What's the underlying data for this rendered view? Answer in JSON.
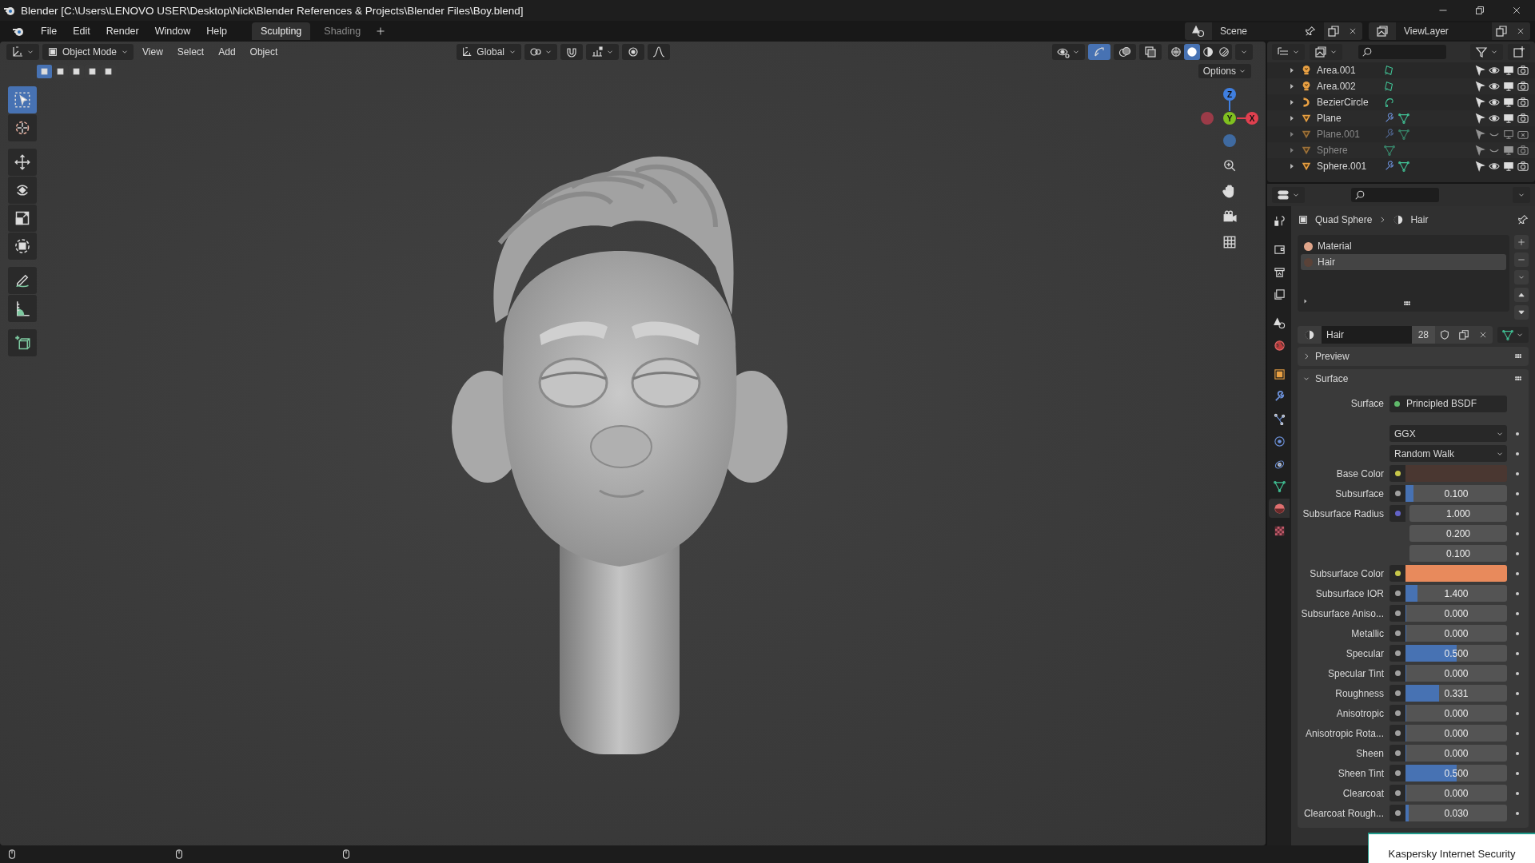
{
  "window": {
    "title": "Blender [C:\\Users\\LENOVO USER\\Desktop\\Nick\\Blender References & Projects\\Blender Files\\Boy.blend]"
  },
  "menu": [
    "File",
    "Edit",
    "Render",
    "Window",
    "Help"
  ],
  "workspaces": [
    {
      "label": "Sculpting",
      "selected": true
    },
    {
      "label": "Shading",
      "selected": false
    }
  ],
  "scene": "Scene",
  "view_layer": "ViewLayer",
  "viewport": {
    "mode": "Object Mode",
    "menus": [
      "View",
      "Select",
      "Add",
      "Object"
    ],
    "orientation": "Global",
    "options": "Options",
    "select_modes": [
      {
        "selected": true
      },
      {
        "selected": false
      },
      {
        "selected": false
      },
      {
        "selected": false
      },
      {
        "selected": false
      }
    ],
    "shading": [
      {
        "kind": "wireframe",
        "selected": false
      },
      {
        "kind": "solid",
        "selected": true
      },
      {
        "kind": "material",
        "selected": false
      },
      {
        "kind": "rendered",
        "selected": false
      }
    ],
    "tools": [
      {
        "kind": "select",
        "selected": true
      },
      {
        "kind": "cursor",
        "selected": false
      },
      {
        "kind": "move",
        "selected": false
      },
      {
        "kind": "rotate",
        "selected": false
      },
      {
        "kind": "scale",
        "selected": false
      },
      {
        "kind": "transform",
        "selected": false
      },
      {
        "kind": "annotate",
        "selected": false
      },
      {
        "kind": "measure",
        "selected": false
      },
      {
        "kind": "add_cube",
        "selected": false
      }
    ],
    "gizmo": {
      "x": "X",
      "y": "Y",
      "z": "Z"
    }
  },
  "outliner": {
    "items": [
      {
        "name": "Area.001",
        "kind": "light",
        "modifier": false,
        "visible": true,
        "render_enabled": true
      },
      {
        "name": "Area.002",
        "kind": "light",
        "modifier": false,
        "visible": true,
        "render_enabled": true
      },
      {
        "name": "BezierCircle",
        "kind": "curve",
        "modifier": false,
        "visible": true,
        "render_enabled": true
      },
      {
        "name": "Plane",
        "kind": "mesh",
        "modifier": true,
        "visible": true,
        "render_enabled": true
      },
      {
        "name": "Plane.001",
        "kind": "mesh",
        "modifier": true,
        "visible": false,
        "render_enabled": false
      },
      {
        "name": "Sphere",
        "kind": "mesh",
        "modifier": false,
        "visible": false,
        "render_enabled": true
      },
      {
        "name": "Sphere.001",
        "kind": "mesh",
        "modifier": true,
        "visible": true,
        "render_enabled": true
      }
    ]
  },
  "properties": {
    "tabs": [
      {
        "kind": "tool",
        "selected": false
      },
      {
        "kind": "render",
        "selected": false
      },
      {
        "kind": "output",
        "selected": false
      },
      {
        "kind": "view_layer",
        "selected": false
      },
      {
        "kind": "scene",
        "selected": false
      },
      {
        "kind": "world",
        "selected": false
      },
      {
        "kind": "object",
        "selected": false
      },
      {
        "kind": "modifiers",
        "selected": false
      },
      {
        "kind": "particles",
        "selected": false
      },
      {
        "kind": "physics",
        "selected": false
      },
      {
        "kind": "constraints",
        "selected": false
      },
      {
        "kind": "data",
        "selected": false
      },
      {
        "kind": "material",
        "selected": true
      },
      {
        "kind": "texture",
        "selected": false
      }
    ],
    "breadcrumb": [
      "Quad Sphere",
      "Hair"
    ],
    "slots": [
      {
        "name": "Material",
        "color": "#e0a58a",
        "selected": false
      },
      {
        "name": "Hair",
        "color": "#5a4238",
        "selected": true
      }
    ],
    "material": {
      "name": "Hair",
      "users": "28"
    },
    "panels": [
      {
        "title": "Preview",
        "expanded": false
      },
      {
        "title": "Surface",
        "expanded": true
      }
    ],
    "surface": {
      "label": "Surface",
      "shader": "Principled BSDF"
    },
    "dropdowns": [
      "GGX",
      "Random Walk"
    ],
    "params": [
      {
        "kind": "color",
        "label": "Base Color",
        "color": "#c7c74a",
        "swatch": {
          "color": "#4a3731"
        }
      },
      {
        "kind": "slider",
        "label": "Subsurface",
        "color": "#a1a1a1",
        "value": "0.100",
        "level": 0.08
      },
      {
        "kind": "vector",
        "label": "Subsurface Radius",
        "color": "#6363c7",
        "values": [
          "1.000",
          "0.200",
          "0.100"
        ]
      },
      {
        "kind": "color",
        "label": "Subsurface Color",
        "color": "#c7c74a",
        "swatch": {
          "color": "#e88a5c"
        }
      },
      {
        "kind": "slider",
        "label": "Subsurface IOR",
        "color": "#a1a1a1",
        "value": "1.400",
        "level": 0.12
      },
      {
        "kind": "slider",
        "label": "Subsurface Aniso...",
        "color": "#a1a1a1",
        "value": "0.000",
        "level": 0
      },
      {
        "kind": "slider",
        "label": "Metallic",
        "color": "#a1a1a1",
        "value": "0.000",
        "level": 0
      },
      {
        "kind": "slider",
        "label": "Specular",
        "color": "#a1a1a1",
        "value": "0.500",
        "level": 0.5
      },
      {
        "kind": "slider",
        "label": "Specular Tint",
        "color": "#a1a1a1",
        "value": "0.000",
        "level": 0
      },
      {
        "kind": "slider",
        "label": "Roughness",
        "color": "#a1a1a1",
        "value": "0.331",
        "level": 0.331
      },
      {
        "kind": "slider",
        "label": "Anisotropic",
        "color": "#a1a1a1",
        "value": "0.000",
        "level": 0
      },
      {
        "kind": "slider",
        "label": "Anisotropic Rota...",
        "color": "#a1a1a1",
        "value": "0.000",
        "level": 0
      },
      {
        "kind": "slider",
        "label": "Sheen",
        "color": "#a1a1a1",
        "value": "0.000",
        "level": 0
      },
      {
        "kind": "slider",
        "label": "Sheen Tint",
        "color": "#a1a1a1",
        "value": "0.500",
        "level": 0.5
      },
      {
        "kind": "slider",
        "label": "Clearcoat",
        "color": "#a1a1a1",
        "value": "0.000",
        "level": 0
      },
      {
        "kind": "slider",
        "label": "Clearcoat Rough...",
        "color": "#a1a1a1",
        "value": "0.030",
        "level": 0.03
      }
    ]
  },
  "notification": {
    "title": "Kaspersky Internet Security"
  }
}
